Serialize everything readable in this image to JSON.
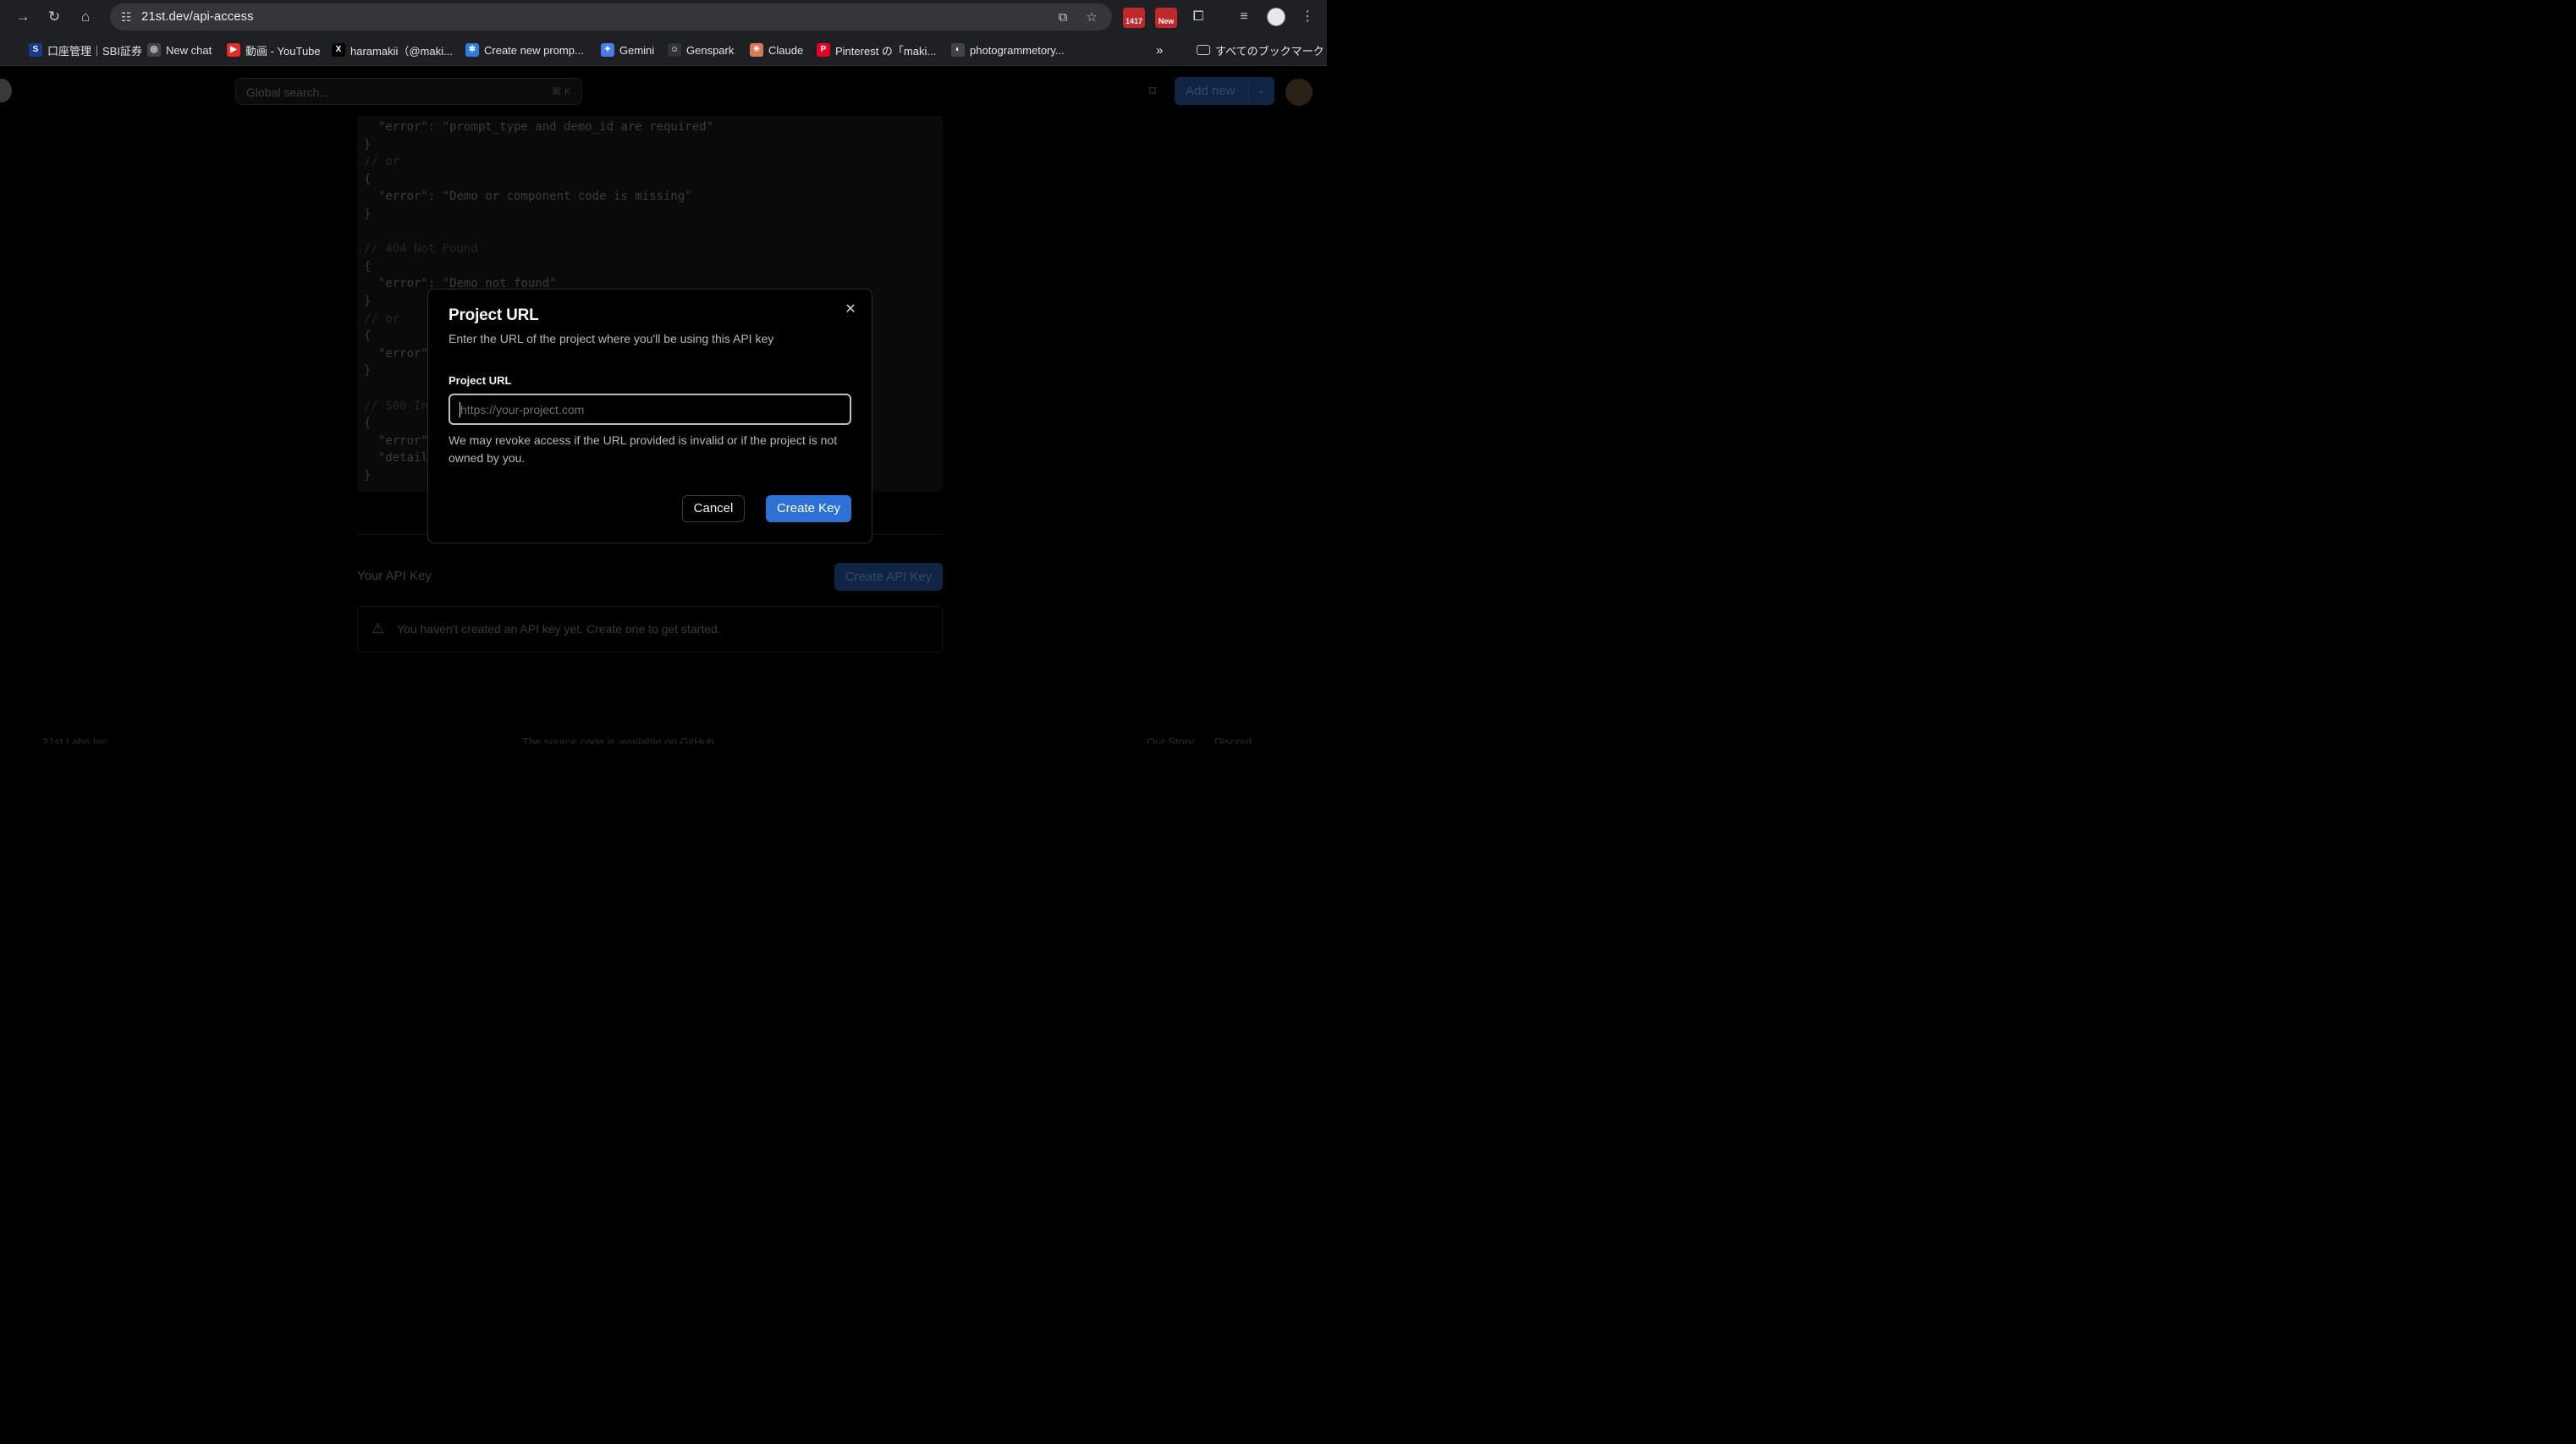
{
  "browser": {
    "url": "21st.dev/api-access",
    "bookmarks": [
      {
        "label": "口座管理｜SBI証券",
        "icon": "sbi-icon",
        "color": "#1a3a8a"
      },
      {
        "label": "New chat",
        "icon": "openai-icon",
        "color": "#444444"
      },
      {
        "label": "動画 - YouTube",
        "icon": "youtube-icon",
        "color": "#e52d27"
      },
      {
        "label": "haramakii（@maki...",
        "icon": "x-icon",
        "color": "#000000"
      },
      {
        "label": "Create new promp...",
        "icon": "butterfly-icon",
        "color": "#2f7be0"
      },
      {
        "label": "Gemini",
        "icon": "gemini-icon",
        "color": "#4b7bec"
      },
      {
        "label": "Genspark",
        "icon": "genspark-icon",
        "color": "#333333"
      },
      {
        "label": "Claude",
        "icon": "claude-icon",
        "color": "#d97757"
      },
      {
        "label": "Pinterest の「maki...",
        "icon": "pinterest-icon",
        "color": "#e60023"
      },
      {
        "label": "photogrammetory...",
        "icon": "photogrammetry-icon",
        "color": "#444444"
      }
    ],
    "all_bookmarks": "すべてのブックマーク",
    "extension_badge_1": "1417",
    "extension_badge_2": "New"
  },
  "header": {
    "search_placeholder": "Global search...",
    "search_shortcut": "⌘ K",
    "add_new_label": "Add new"
  },
  "code_lines": [
    {
      "text": "  \"error\": \"prompt_type and demo_id are required\"",
      "comment": false
    },
    {
      "text": "}",
      "comment": false
    },
    {
      "text": "// or",
      "comment": true
    },
    {
      "text": "{",
      "comment": false
    },
    {
      "text": "  \"error\": \"Demo or component code is missing\"",
      "comment": false
    },
    {
      "text": "}",
      "comment": false
    },
    {
      "text": "",
      "comment": false
    },
    {
      "text": "// 404 Not Found",
      "comment": true
    },
    {
      "text": "{",
      "comment": false
    },
    {
      "text": "  \"error\": \"Demo not found\"",
      "comment": false
    },
    {
      "text": "}",
      "comment": false
    },
    {
      "text": "// or",
      "comment": true
    },
    {
      "text": "{",
      "comment": false
    },
    {
      "text": "  \"error\"",
      "comment": false
    },
    {
      "text": "}",
      "comment": false
    },
    {
      "text": "",
      "comment": false
    },
    {
      "text": "// 500 In",
      "comment": true
    },
    {
      "text": "{",
      "comment": false
    },
    {
      "text": "  \"error\"",
      "comment": false
    },
    {
      "text": "  \"detail",
      "comment": false
    },
    {
      "text": "}",
      "comment": false
    }
  ],
  "api_section": {
    "title": "Your API Key",
    "create_button": "Create API Key",
    "notice": "You haven't created an API key yet. Create one to get started."
  },
  "footer": {
    "left": "21st Labs Inc.",
    "center": "The source code is available on GitHub.",
    "right_1": "Our Story",
    "right_2": "Discord"
  },
  "modal": {
    "title": "Project URL",
    "subtitle": "Enter the URL of the project where you'll be using this API key",
    "field_label": "Project URL",
    "input_placeholder": "https://your-project.com",
    "input_value": "",
    "help_text": "We may revoke access if the URL provided is invalid or if the project is not owned by you.",
    "cancel_label": "Cancel",
    "create_label": "Create Key",
    "accent_color": "#2d71d6"
  }
}
